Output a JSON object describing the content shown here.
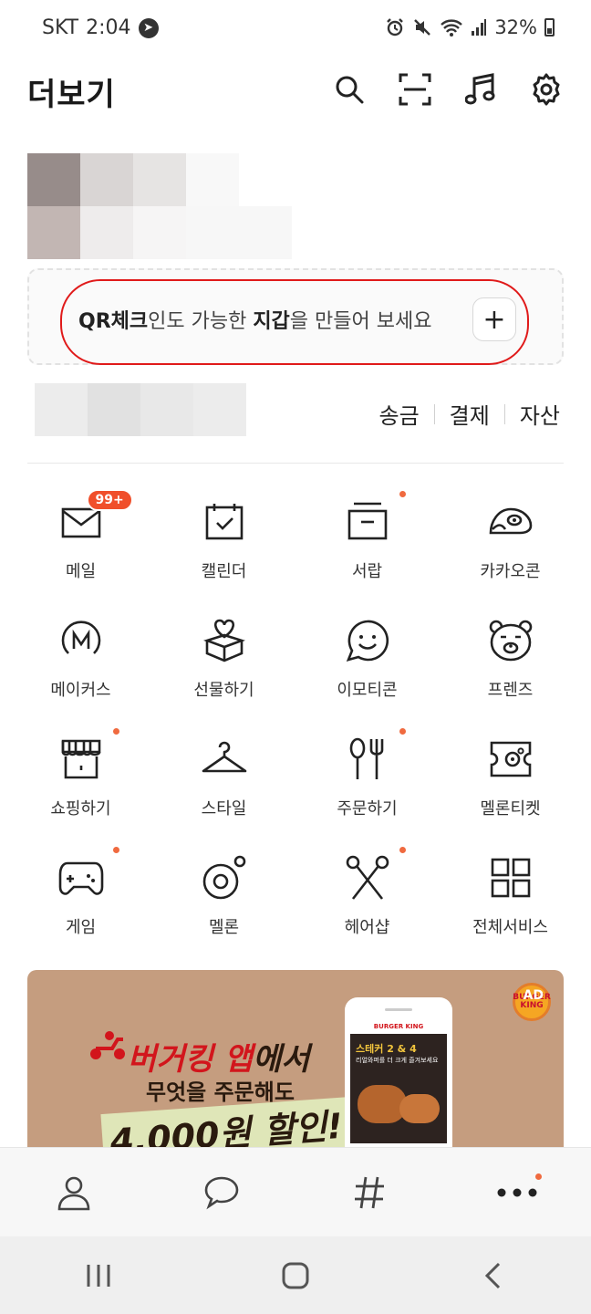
{
  "status_bar": {
    "carrier": "SKT",
    "time": "2:04",
    "battery": "32%"
  },
  "header": {
    "title": "더보기"
  },
  "wallet": {
    "text_bold1": "QR체크",
    "text_mid": "인도 가능한 ",
    "text_bold2": "지갑",
    "text_end": "을 만들어 보세요",
    "add_label": "+"
  },
  "pay": {
    "links": [
      "송금",
      "결제",
      "자산"
    ]
  },
  "services": [
    {
      "label": "메일",
      "badge": "99+"
    },
    {
      "label": "캘린더"
    },
    {
      "label": "서랍"
    },
    {
      "label": "카카오콘"
    },
    {
      "label": "메이커스"
    },
    {
      "label": "선물하기"
    },
    {
      "label": "이모티콘"
    },
    {
      "label": "프렌즈"
    },
    {
      "label": "쇼핑하기"
    },
    {
      "label": "스타일"
    },
    {
      "label": "주문하기"
    },
    {
      "label": "멜론티켓"
    },
    {
      "label": "게임"
    },
    {
      "label": "멜론"
    },
    {
      "label": "헤어샵"
    },
    {
      "label": "전체서비스"
    }
  ],
  "ad": {
    "line1_a": "버거킹 앱",
    "line1_b": "에서",
    "line2": "무엇을 주문해도",
    "line3": "4,000원 할인!!",
    "tag": "AD",
    "brand": "BURGER KING",
    "phone_brand": "BURGER KING",
    "phone_title": "스테커 2 & 4",
    "phone_sub": "리얼와퍼를 더 크게 즐겨보세요"
  },
  "colors": {
    "accent_red": "#e01a1a",
    "dot_orange": "#f06a3f",
    "badge": "#f04f2b"
  }
}
